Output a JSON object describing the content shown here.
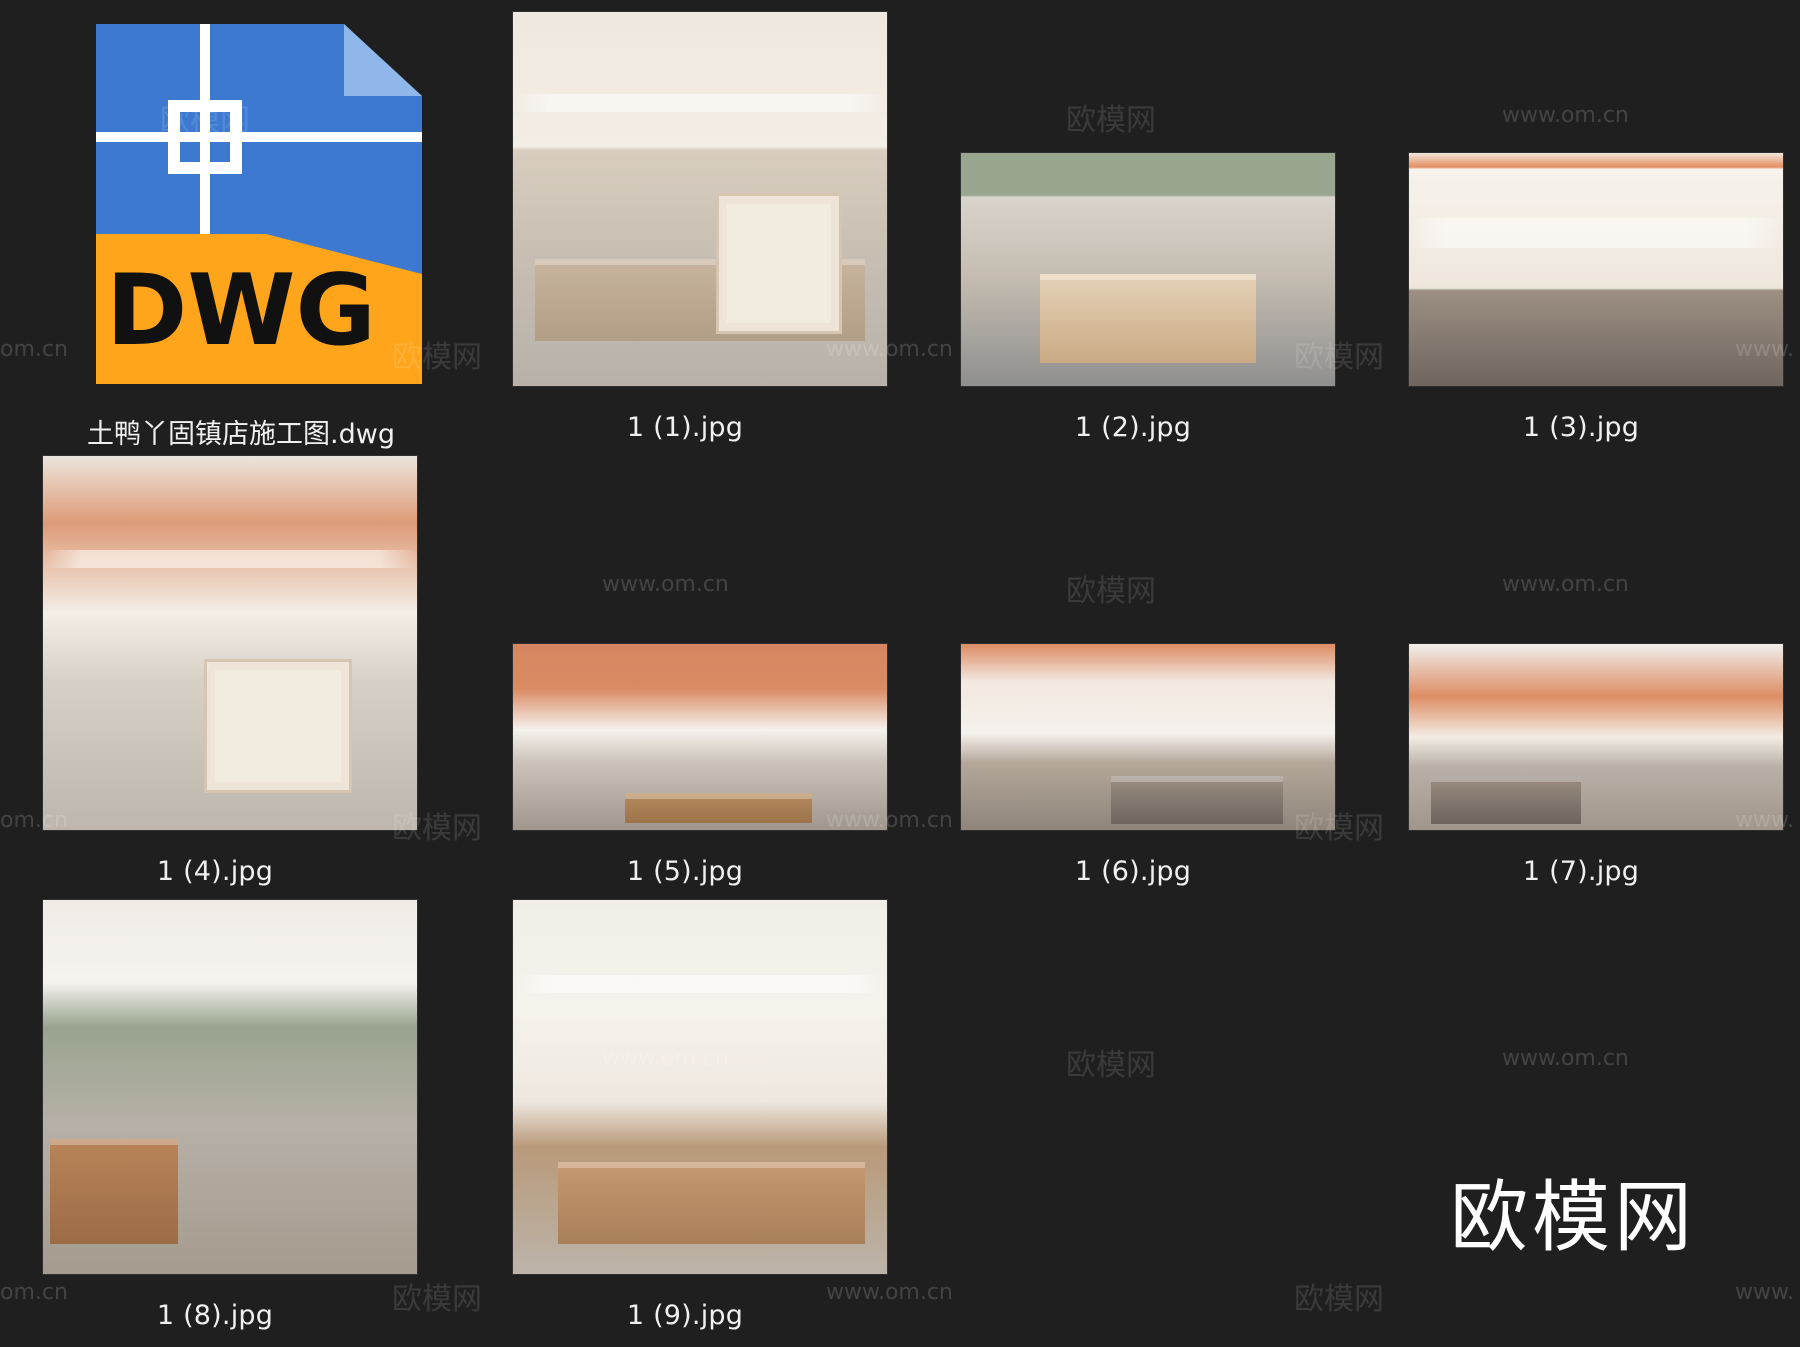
{
  "files": [
    {
      "name": "土鸭丫固镇店施工图.dwg",
      "icon_text": "DWG",
      "kind": "dwg"
    },
    {
      "name": "1 (1).jpg",
      "kind": "jpg"
    },
    {
      "name": "1 (2).jpg",
      "kind": "jpg"
    },
    {
      "name": "1 (3).jpg",
      "kind": "jpg"
    },
    {
      "name": "1 (4).jpg",
      "kind": "jpg"
    },
    {
      "name": "1 (5).jpg",
      "kind": "jpg"
    },
    {
      "name": "1 (6).jpg",
      "kind": "jpg"
    },
    {
      "name": "1 (7).jpg",
      "kind": "jpg"
    },
    {
      "name": "1 (8).jpg",
      "kind": "jpg"
    },
    {
      "name": "1 (9).jpg",
      "kind": "jpg"
    }
  ],
  "watermarks": [
    "欧模网",
    "www.om.cn",
    "om.cn",
    "www."
  ],
  "brand_logo": "欧模网",
  "colors": {
    "background": "#1f1f1f",
    "dwg_blue": "#3d79d0",
    "dwg_orange": "#ffa51b",
    "dwg_text": "#111111"
  }
}
